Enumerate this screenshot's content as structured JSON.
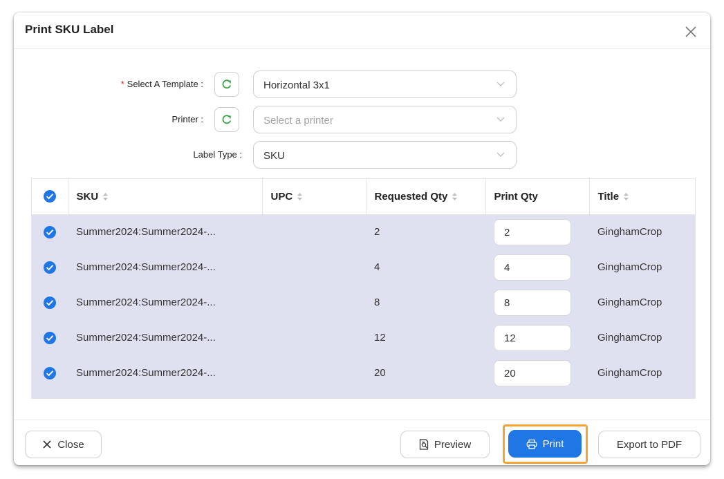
{
  "dialog": {
    "title": "Print SKU Label"
  },
  "form": {
    "template": {
      "label": "Select A Template :",
      "required_mark": "*",
      "value": "Horizontal 3x1"
    },
    "printer": {
      "label": "Printer :",
      "placeholder": "Select a printer"
    },
    "label_type": {
      "label": "Label Type :",
      "value": "SKU"
    }
  },
  "table": {
    "columns": [
      "SKU",
      "UPC",
      "Requested Qty",
      "Print Qty",
      "Title"
    ],
    "rows": [
      {
        "sku": "Summer2024:Summer2024-...",
        "upc": "",
        "requested_qty": "2",
        "print_qty": "2",
        "title": "GinghamCrop"
      },
      {
        "sku": "Summer2024:Summer2024-...",
        "upc": "",
        "requested_qty": "4",
        "print_qty": "4",
        "title": "GinghamCrop"
      },
      {
        "sku": "Summer2024:Summer2024-...",
        "upc": "",
        "requested_qty": "8",
        "print_qty": "8",
        "title": "GinghamCrop"
      },
      {
        "sku": "Summer2024:Summer2024-...",
        "upc": "",
        "requested_qty": "12",
        "print_qty": "12",
        "title": "GinghamCrop"
      },
      {
        "sku": "Summer2024:Summer2024-...",
        "upc": "",
        "requested_qty": "20",
        "print_qty": "20",
        "title": "GinghamCrop"
      }
    ]
  },
  "footer": {
    "close_label": "Close",
    "preview_label": "Preview",
    "print_label": "Print",
    "export_label": "Export to PDF"
  },
  "colors": {
    "accent": "#1f76e5",
    "selected_row": "#dfe1f1",
    "highlight": "#f4a531",
    "refresh_icon": "#2e9e3e",
    "required": "#e02020"
  }
}
